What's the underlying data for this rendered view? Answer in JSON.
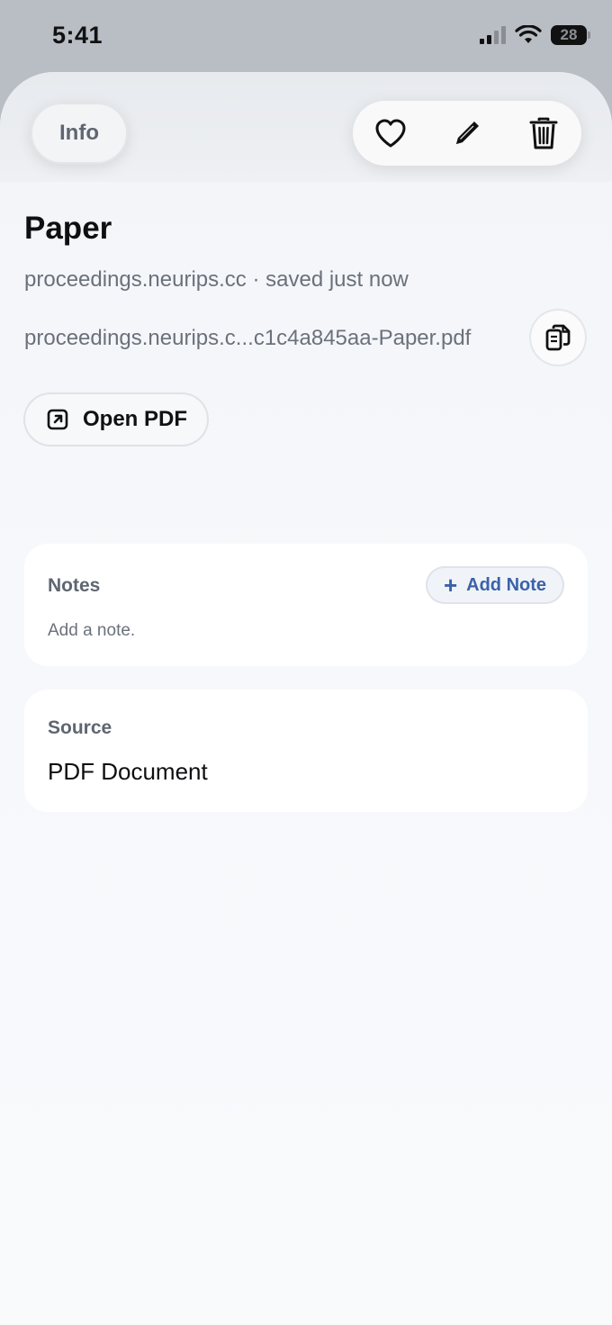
{
  "status_bar": {
    "time": "5:41",
    "battery_level": "28",
    "icons": [
      "signal-icon",
      "wifi-icon",
      "battery-icon"
    ]
  },
  "header": {
    "info_label": "Info",
    "actions": [
      "heart-icon",
      "pencil-icon",
      "trash-icon"
    ]
  },
  "document": {
    "title": "Paper",
    "subtitle": "proceedings.neurips.cc · saved just now",
    "file_url": "proceedings.neurips.c...c1c4a845aa-Paper.pdf",
    "copy_icon": "copy-icon",
    "open_pdf_label": "Open PDF",
    "open_icon": "external-link-icon"
  },
  "notes": {
    "label": "Notes",
    "add_label": "Add Note",
    "empty_hint": "Add a note."
  },
  "source": {
    "label": "Source",
    "value": "PDF Document"
  },
  "colors": {
    "accent": "#3a62a8",
    "secondary_text": "#6b717b",
    "primary_text": "#0e0f11",
    "status_bar_bg": "#b9bdc4"
  }
}
